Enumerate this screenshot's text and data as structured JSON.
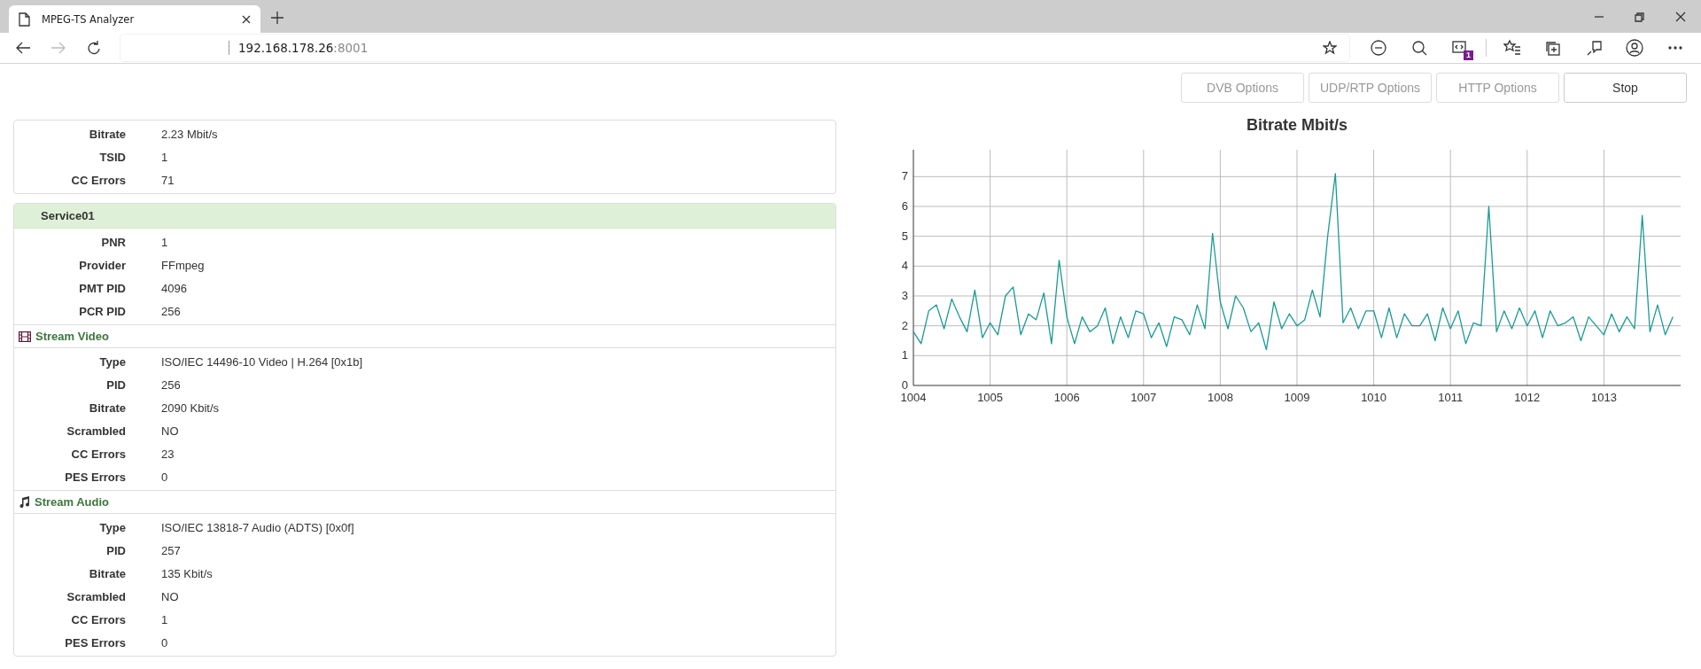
{
  "browser": {
    "tab_title": "MPEG-TS Analyzer",
    "url_host": "192.168.178.26",
    "url_port": ":8001",
    "forward_disabled": true,
    "extension_badge": "1"
  },
  "buttons": [
    {
      "label": "DVB Options",
      "disabled": true
    },
    {
      "label": "UDP/RTP Options",
      "disabled": true
    },
    {
      "label": "HTTP Options",
      "disabled": true
    },
    {
      "label": "Stop",
      "disabled": false
    }
  ],
  "transport": {
    "rows": [
      {
        "label": "Bitrate",
        "value": "2.23 Mbit/s"
      },
      {
        "label": "TSID",
        "value": "1"
      },
      {
        "label": "CC Errors",
        "value": "71"
      }
    ]
  },
  "services": [
    {
      "name": "Service01",
      "rows": [
        {
          "label": "PNR",
          "value": "1"
        },
        {
          "label": "Provider",
          "value": "FFmpeg"
        },
        {
          "label": "PMT PID",
          "value": "4096"
        },
        {
          "label": "PCR PID",
          "value": "256"
        }
      ],
      "streams": [
        {
          "kind": "video",
          "title": "Stream Video",
          "rows": [
            {
              "label": "Type",
              "value": "ISO/IEC 14496-10 Video | H.264 [0x1b]"
            },
            {
              "label": "PID",
              "value": "256"
            },
            {
              "label": "Bitrate",
              "value": "2090 Kbit/s"
            },
            {
              "label": "Scrambled",
              "value": "NO"
            },
            {
              "label": "CC Errors",
              "value": "23"
            },
            {
              "label": "PES Errors",
              "value": "0"
            }
          ]
        },
        {
          "kind": "audio",
          "title": "Stream Audio",
          "rows": [
            {
              "label": "Type",
              "value": "ISO/IEC 13818-7 Audio (ADTS) [0x0f]"
            },
            {
              "label": "PID",
              "value": "257"
            },
            {
              "label": "Bitrate",
              "value": "135 Kbit/s"
            },
            {
              "label": "Scrambled",
              "value": "NO"
            },
            {
              "label": "CC Errors",
              "value": "1"
            },
            {
              "label": "PES Errors",
              "value": "0"
            }
          ]
        }
      ]
    }
  ],
  "chart": {
    "chart_data": {
      "type": "line",
      "title": "Bitrate Mbit/s",
      "grid": true,
      "xlim": [
        1004,
        1014
      ],
      "ylim": [
        0,
        7.9
      ],
      "xticks": [
        1004,
        1005,
        1006,
        1007,
        1008,
        1009,
        1010,
        1011,
        1012,
        1013
      ],
      "yticks": [
        0,
        1,
        2,
        3,
        4,
        5,
        6,
        7
      ],
      "x": [
        1004.0,
        1004.1,
        1004.2,
        1004.3,
        1004.4,
        1004.5,
        1004.6,
        1004.7,
        1004.8,
        1004.9,
        1005.0,
        1005.1,
        1005.2,
        1005.3,
        1005.4,
        1005.5,
        1005.6,
        1005.7,
        1005.8,
        1005.9,
        1006.0,
        1006.1,
        1006.2,
        1006.3,
        1006.4,
        1006.5,
        1006.6,
        1006.7,
        1006.8,
        1006.9,
        1007.0,
        1007.1,
        1007.2,
        1007.3,
        1007.4,
        1007.5,
        1007.6,
        1007.7,
        1007.8,
        1007.9,
        1008.0,
        1008.1,
        1008.2,
        1008.3,
        1008.4,
        1008.5,
        1008.6,
        1008.7,
        1008.8,
        1008.9,
        1009.0,
        1009.1,
        1009.2,
        1009.3,
        1009.4,
        1009.5,
        1009.6,
        1009.7,
        1009.8,
        1009.9,
        1010.0,
        1010.1,
        1010.2,
        1010.3,
        1010.4,
        1010.5,
        1010.6,
        1010.7,
        1010.8,
        1010.9,
        1011.0,
        1011.1,
        1011.2,
        1011.3,
        1011.4,
        1011.5,
        1011.6,
        1011.7,
        1011.8,
        1011.9,
        1012.0,
        1012.1,
        1012.2,
        1012.3,
        1012.4,
        1012.5,
        1012.6,
        1012.7,
        1012.8,
        1012.9,
        1013.0,
        1013.1,
        1013.2,
        1013.3,
        1013.4,
        1013.5,
        1013.6,
        1013.7,
        1013.8,
        1013.9
      ],
      "series": [
        {
          "color": "#1a9a96",
          "values": [
            1.8,
            1.4,
            2.5,
            2.7,
            1.9,
            2.9,
            2.3,
            1.8,
            3.2,
            1.6,
            2.1,
            1.7,
            3.0,
            3.3,
            1.7,
            2.4,
            2.2,
            3.1,
            1.4,
            4.2,
            2.3,
            1.4,
            2.3,
            1.8,
            2.0,
            2.6,
            1.4,
            2.3,
            1.6,
            2.5,
            2.4,
            1.6,
            2.1,
            1.3,
            2.3,
            2.2,
            1.7,
            2.7,
            1.9,
            5.1,
            2.8,
            1.9,
            3.0,
            2.6,
            1.8,
            2.1,
            1.2,
            2.8,
            1.9,
            2.4,
            2.0,
            2.2,
            3.2,
            2.3,
            5.0,
            7.1,
            2.1,
            2.6,
            1.9,
            2.5,
            2.5,
            1.6,
            2.6,
            1.6,
            2.4,
            2.0,
            2.0,
            2.4,
            1.5,
            2.6,
            1.9,
            2.5,
            1.4,
            2.1,
            2.0,
            6.0,
            1.8,
            2.5,
            1.9,
            2.6,
            2.0,
            2.5,
            1.6,
            2.5,
            2.0,
            2.1,
            2.3,
            1.5,
            2.3,
            2.0,
            1.7,
            2.4,
            1.8,
            2.3,
            1.9,
            5.7,
            1.8,
            2.7,
            1.7,
            2.3
          ]
        }
      ]
    }
  }
}
